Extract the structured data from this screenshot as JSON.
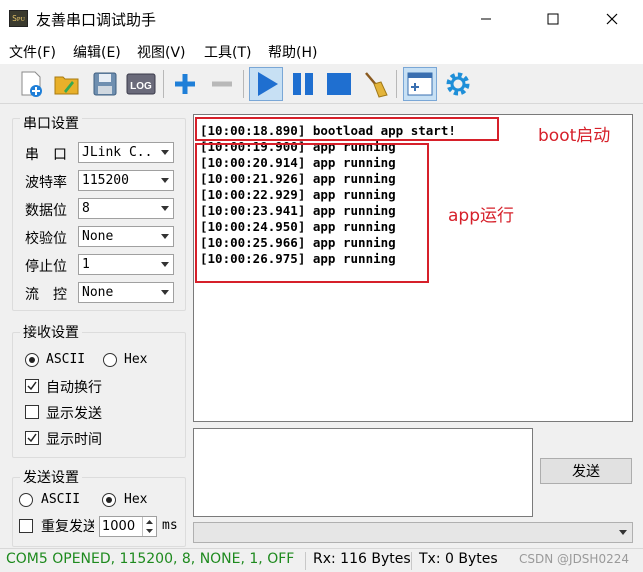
{
  "window": {
    "title": "友善串口调试助手",
    "app_icon_text": "Sᴘᴜ"
  },
  "menu": [
    "文件(F)",
    "编辑(E)",
    "视图(V)",
    "工具(T)",
    "帮助(H)"
  ],
  "toolbar": {
    "log_label": "LOG"
  },
  "serial_settings": {
    "title": "串口设置",
    "rows": [
      {
        "label": "串　口",
        "value": "JLink C..."
      },
      {
        "label": "波特率",
        "value": "115200"
      },
      {
        "label": "数据位",
        "value": "8"
      },
      {
        "label": "校验位",
        "value": "None"
      },
      {
        "label": "停止位",
        "value": "1"
      },
      {
        "label": "流　控",
        "value": "None"
      }
    ]
  },
  "receive_settings": {
    "title": "接收设置",
    "ascii_label": "ASCII",
    "hex_label": "Hex",
    "mode_selected": "ASCII",
    "options": [
      {
        "label": "自动换行",
        "checked": true
      },
      {
        "label": "显示发送",
        "checked": false
      },
      {
        "label": "显示时间",
        "checked": true
      }
    ]
  },
  "send_settings": {
    "title": "发送设置",
    "ascii_label": "ASCII",
    "hex_label": "Hex",
    "mode_selected": "Hex",
    "repeat_label": "重复发送",
    "repeat_checked": false,
    "interval_value": "1000",
    "interval_unit": "ms"
  },
  "receive_log": [
    "[10:00:18.890] bootload app start!",
    "[10:00:19.900] app running",
    "[10:00:20.914] app running",
    "[10:00:21.926] app running",
    "[10:00:22.929] app running",
    "[10:00:23.941] app running",
    "[10:00:24.950] app running",
    "[10:00:25.966] app running",
    "[10:00:26.975] app running"
  ],
  "annotations": {
    "boot": "boot启动",
    "app": "app运行"
  },
  "send": {
    "button_label": "发送",
    "text": ""
  },
  "status": {
    "port": "COM5 OPENED, 115200, 8, NONE, 1, OFF",
    "rx": "Rx: 116 Bytes",
    "tx": "Tx: 0 Bytes",
    "watermark": "CSDN @JDSH0224"
  },
  "colors": {
    "status_green": "#1e8a1e",
    "annotation_red": "#d6202a",
    "play_blue": "#1f6fd0"
  }
}
